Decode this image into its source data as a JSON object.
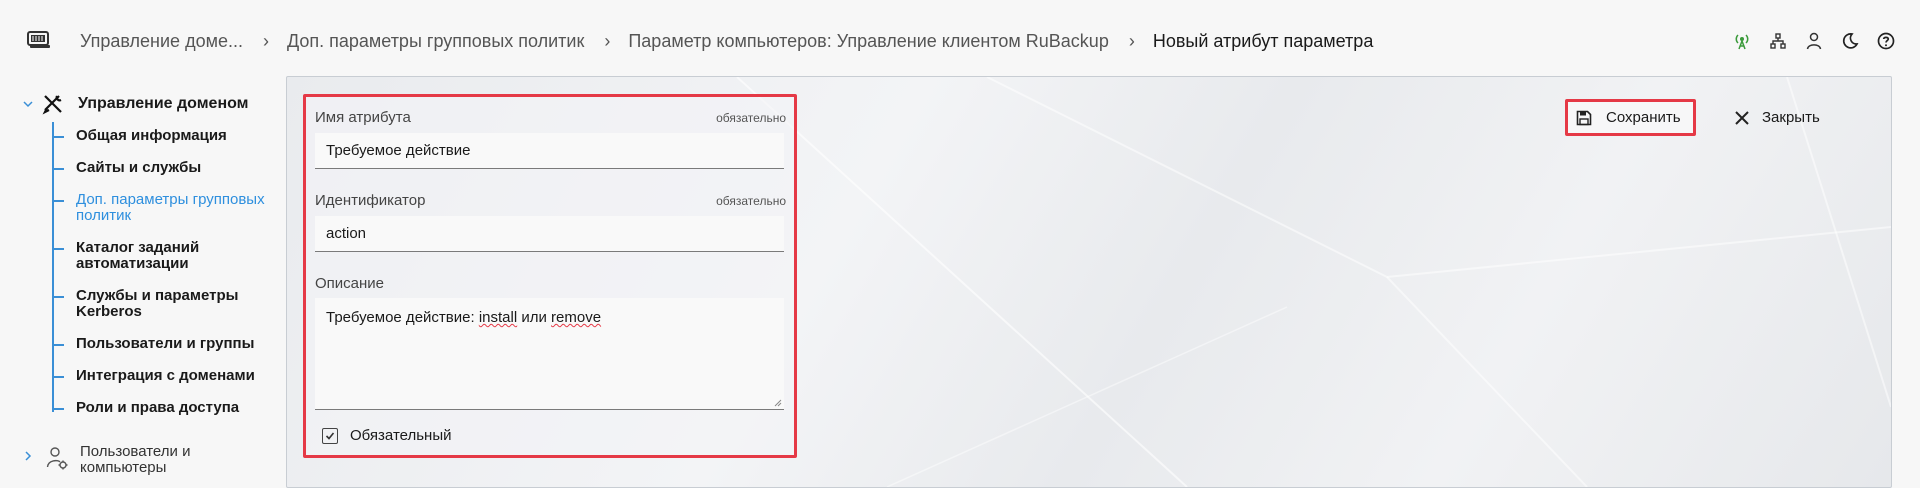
{
  "header": {
    "logo_icon": "monitor-logo-icon",
    "breadcrumbs": [
      {
        "label": "Управление доме..."
      },
      {
        "label": "Доп. параметры групповых политик"
      },
      {
        "label": "Параметр компьютеров: Управление клиентом RuBackup"
      },
      {
        "label": "Новый атрибут параметра"
      }
    ],
    "icons": [
      "antenna-icon",
      "network-icon",
      "user-icon",
      "moon-icon",
      "help-icon"
    ],
    "antenna_color": "#3a9a3a"
  },
  "sidebar": {
    "root": {
      "label": "Управление доменом",
      "icon": "tools-icon",
      "expanded": true
    },
    "items": [
      {
        "label": "Общая информация"
      },
      {
        "label": "Сайты и службы"
      },
      {
        "label": "Доп. параметры групповых политик",
        "active": true
      },
      {
        "label": "Каталог заданий автоматизации"
      },
      {
        "label": "Службы и параметры Kerberos"
      },
      {
        "label": "Пользователи и группы"
      },
      {
        "label": "Интеграция с доменами"
      },
      {
        "label": "Роли и права доступа"
      }
    ],
    "collapsed_item": {
      "label": "Пользователи и компьютеры",
      "icon": "user-gear-icon"
    },
    "accent_color": "#3a8fd6"
  },
  "form": {
    "attribute_name": {
      "label": "Имя атрибута",
      "required_text": "обязательно",
      "value": "Требуемое действие"
    },
    "identifier": {
      "label": "Идентификатор",
      "required_text": "обязательно",
      "value": "action"
    },
    "description": {
      "label": "Описание",
      "value_prefix": "Требуемое действие: ",
      "word1": "install",
      "middle": " или ",
      "word2": "remove"
    },
    "required_checkbox": {
      "label": "Обязательный",
      "checked": true
    }
  },
  "actions": {
    "save_label": "Сохранить",
    "close_label": "Закрыть"
  },
  "highlight_color": "#e53946"
}
